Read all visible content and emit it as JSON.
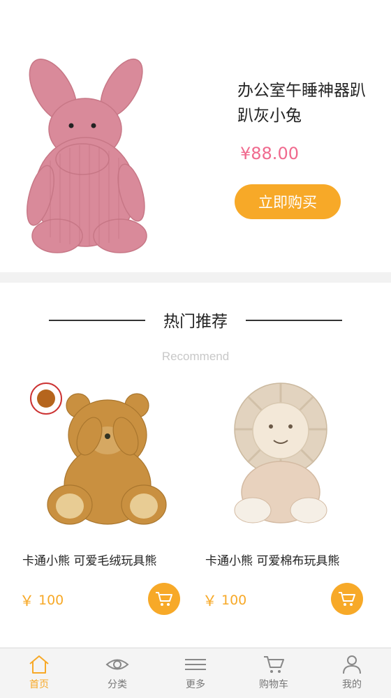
{
  "featured": {
    "title": "办公室午睡神器趴趴灰小兔",
    "price": "¥88.00",
    "buy_label": "立即购买"
  },
  "recommend": {
    "title": "热门推荐",
    "subtitle": "Recommend",
    "products": [
      {
        "name": "卡通小熊 可爱毛绒玩具熊",
        "currency": "￥",
        "price": "100"
      },
      {
        "name": "卡通小熊 可爱棉布玩具熊",
        "currency": "￥",
        "price": "100"
      }
    ]
  },
  "tabbar": {
    "items": [
      {
        "label": "首页",
        "icon": "home-icon",
        "active": true
      },
      {
        "label": "分类",
        "icon": "eye-icon",
        "active": false
      },
      {
        "label": "更多",
        "icon": "menu-icon",
        "active": false
      },
      {
        "label": "购物车",
        "icon": "cart-icon",
        "active": false
      },
      {
        "label": "我的",
        "icon": "user-icon",
        "active": false
      }
    ]
  },
  "colors": {
    "accent": "#f7a928",
    "price_pink": "#f06a8e",
    "plush_pink": "#d98a9a"
  }
}
